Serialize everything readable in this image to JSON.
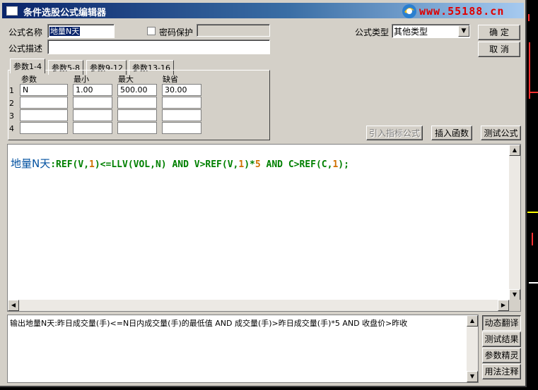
{
  "window": {
    "title": "条件选股公式编辑器"
  },
  "logo": {
    "text": "www.55188.cn"
  },
  "form": {
    "name_label": "公式名称",
    "name_value": "地量N天",
    "password_label": "密码保护",
    "password_value": "",
    "desc_label": "公式描述",
    "desc_value": "",
    "type_label": "公式类型",
    "type_value": "其他类型"
  },
  "buttons": {
    "ok": "确  定",
    "cancel": "取  消",
    "import": "引入指标公式",
    "insert": "插入函数",
    "test": "测试公式"
  },
  "tabs": [
    "参数1-4",
    "参数5-8",
    "参数9-12",
    "参数13-16"
  ],
  "params": {
    "headers": [
      "参数",
      "最小",
      "最大",
      "缺省"
    ],
    "rows": [
      {
        "n": "1",
        "name": "N",
        "min": "1.00",
        "max": "500.00",
        "def": "30.00"
      },
      {
        "n": "2",
        "name": "",
        "min": "",
        "max": "",
        "def": ""
      },
      {
        "n": "3",
        "name": "",
        "min": "",
        "max": "",
        "def": ""
      },
      {
        "n": "4",
        "name": "",
        "min": "",
        "max": "",
        "def": ""
      }
    ]
  },
  "code": {
    "name": "地量N天",
    "p1": ":REF(V,",
    "n1": "1",
    "p2": ")<=LLV(VOL,N) ",
    "and1": "AND",
    "p3": " V>REF(V,",
    "n2": "1",
    "p4": ")*",
    "n3": "5",
    "and2": "AND",
    "p5": " C>REF(C,",
    "n4": "1",
    "p6": ");"
  },
  "output": {
    "text": "输出地量N天:昨日成交量(手)<=N日内成交量(手)的最低值 AND 成交量(手)>昨日成交量(手)*5 AND 收盘价>昨收"
  },
  "side_buttons": [
    "动态翻译",
    "测试结果",
    "参数精灵",
    "用法注释"
  ],
  "icons": {
    "up": "scroll-up-icon",
    "down": "scroll-down-icon",
    "left": "scroll-left-icon",
    "right": "scroll-right-icon",
    "combo": "chevron-down-icon"
  }
}
